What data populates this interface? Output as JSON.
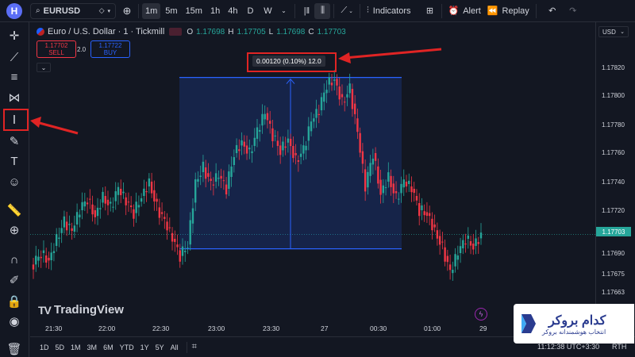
{
  "topbar": {
    "avatar_letter": "H",
    "symbol": "EURUSD",
    "intervals": [
      "1m",
      "5m",
      "15m",
      "1h",
      "4h",
      "D",
      "W"
    ],
    "active_interval": "1m",
    "indicators_label": "Indicators",
    "alert_label": "Alert",
    "replay_label": "Replay"
  },
  "legend": {
    "title": "Euro / U.S. Dollar · 1 · Tickmill",
    "o_label": "O",
    "o_value": "1.17698",
    "h_label": "H",
    "h_value": "1.17705",
    "l_label": "L",
    "l_value": "1.17698",
    "c_label": "C",
    "c_value": "1.17703"
  },
  "trade": {
    "sell_price": "1.17702",
    "sell_label": "SELL",
    "spread": "2.0",
    "buy_price": "1.17722",
    "buy_label": "BUY"
  },
  "measure": {
    "label": "0.00120 (0.10%) 12.0"
  },
  "price_axis": {
    "currency": "USD",
    "ticks": [
      "1.17820",
      "1.17800",
      "1.17780",
      "1.17760",
      "1.17740",
      "1.17720",
      "1.17690",
      "1.17675",
      "1.17663",
      "1.17640"
    ],
    "current": "1.17703"
  },
  "time_axis": {
    "ticks": [
      "21:30",
      "22:00",
      "22:30",
      "23:00",
      "23:30",
      "27",
      "00:30",
      "01:00",
      "29"
    ]
  },
  "bottombar": {
    "ranges": [
      "1D",
      "5D",
      "1M",
      "3M",
      "6M",
      "YTD",
      "1Y",
      "5Y",
      "All"
    ],
    "clock": "11:12:38 UTC+3:30",
    "session": "RTH"
  },
  "watermark": {
    "text": "TradingView",
    "mark": "TV"
  },
  "broker": {
    "name": "کدام بروکر",
    "tagline": "انتخاب هوشمندانه بروکر"
  },
  "colors": {
    "up": "#26a69a",
    "down": "#f23645",
    "measure": "#2962ff",
    "highlight": "#e02424",
    "background": "#131722"
  },
  "chart_data": {
    "type": "candlestick",
    "close_series": [
      1.17682,
      1.1769,
      1.17685,
      1.177,
      1.17712,
      1.17705,
      1.1772,
      1.17728,
      1.17716,
      1.1773,
      1.17722,
      1.17735,
      1.17726,
      1.17718,
      1.1773,
      1.1774,
      1.17722,
      1.17712,
      1.177,
      1.17688,
      1.17696,
      1.1774,
      1.1775,
      1.17738,
      1.17744,
      1.17735,
      1.1776,
      1.17768,
      1.1776,
      1.17775,
      1.17788,
      1.17772,
      1.17762,
      1.1777,
      1.17755,
      1.17762,
      1.17782,
      1.1779,
      1.17808,
      1.17812,
      1.17796,
      1.17805,
      1.17774,
      1.17736,
      1.1776,
      1.17732,
      1.17744,
      1.17728,
      1.1774,
      1.17735,
      1.1772,
      1.17718,
      1.17706,
      1.17694,
      1.17676,
      1.1769,
      1.177,
      1.17695,
      1.17703
    ],
    "measure_range": {
      "from": 1.17693,
      "to": 1.17813,
      "change": "0.00120 (0.10%) 12.0"
    }
  }
}
